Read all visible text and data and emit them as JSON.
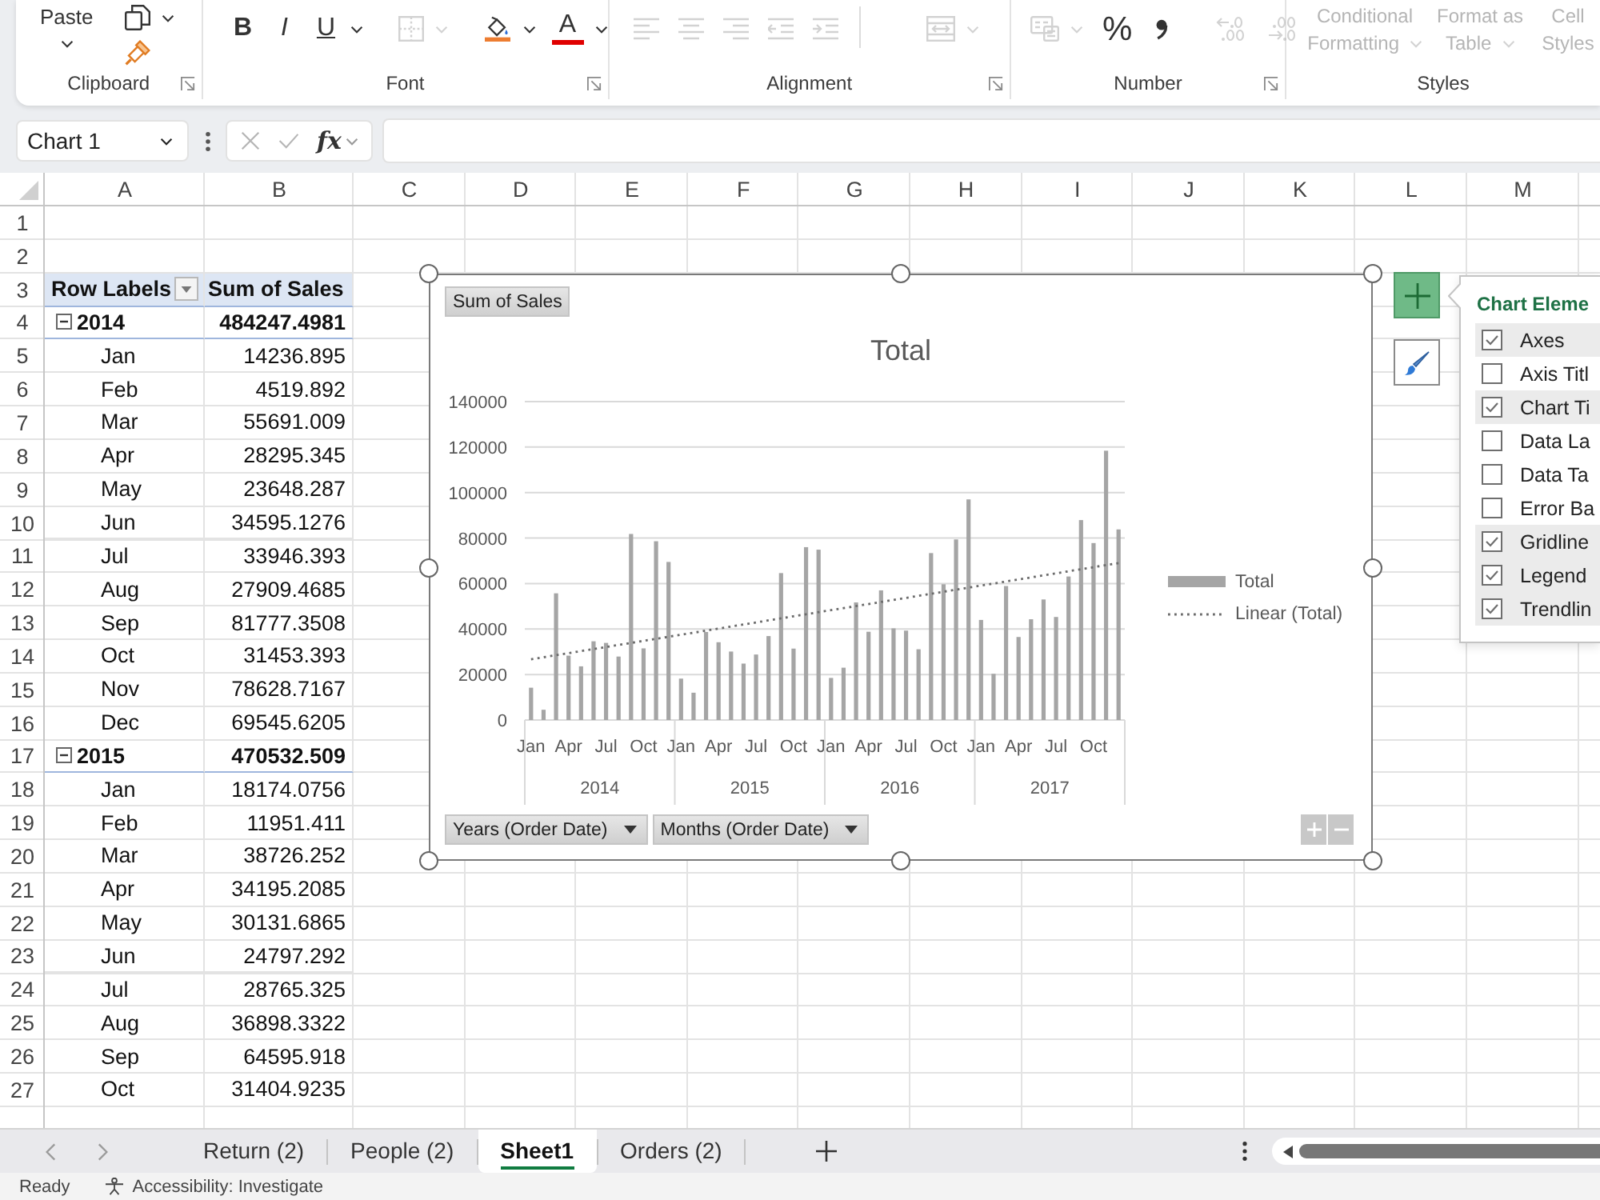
{
  "ribbon": {
    "groups": [
      {
        "kind": "clipboard",
        "label": "Clipboard",
        "launcher": true,
        "tools": [
          {
            "kind": "paste",
            "label": "Paste",
            "disabled": false
          },
          {
            "kind": "copy",
            "disabled": false
          },
          {
            "kind": "format-painter",
            "disabled": false
          }
        ]
      },
      {
        "kind": "font",
        "label": "Font",
        "launcher": true,
        "tools": [
          {
            "kind": "bold",
            "label": "B",
            "disabled": false
          },
          {
            "kind": "italic",
            "label": "I",
            "disabled": false
          },
          {
            "kind": "underline",
            "label": "U",
            "disabled": false
          },
          {
            "kind": "borders",
            "disabled": true
          },
          {
            "kind": "fill-color",
            "disabled": false
          },
          {
            "kind": "font-color",
            "label": "A",
            "disabled": false
          }
        ]
      },
      {
        "kind": "alignment",
        "label": "Alignment",
        "launcher": true,
        "tools": [
          {
            "kind": "align-left",
            "disabled": true
          },
          {
            "kind": "align-center",
            "disabled": true
          },
          {
            "kind": "align-right",
            "disabled": true
          },
          {
            "kind": "decrease-indent",
            "disabled": true
          },
          {
            "kind": "increase-indent",
            "disabled": true
          },
          {
            "kind": "merge",
            "disabled": true
          }
        ]
      },
      {
        "kind": "number",
        "label": "Number",
        "launcher": true,
        "tools": [
          {
            "kind": "number-format",
            "disabled": true
          },
          {
            "kind": "percent",
            "label": "%",
            "disabled": false
          },
          {
            "kind": "comma",
            "disabled": false
          },
          {
            "kind": "increase-decimal",
            "disabled": true
          },
          {
            "kind": "decrease-decimal",
            "disabled": true
          }
        ]
      },
      {
        "kind": "styles",
        "label": "Styles",
        "launcher": false,
        "tools": [
          {
            "kind": "conditional-formatting",
            "label": "Conditional Formatting",
            "disabled": true
          },
          {
            "kind": "format-as-table",
            "label": "Format as Table",
            "disabled": true
          },
          {
            "kind": "cell-styles",
            "label": "Cell Styles",
            "disabled": true
          }
        ]
      }
    ]
  },
  "formula_bar": {
    "name_box": "Chart 1",
    "function_label": "fx"
  },
  "sheet": {
    "columns": [
      "A",
      "B",
      "C",
      "D",
      "E",
      "F",
      "G",
      "H",
      "I",
      "J",
      "K",
      "L",
      "M"
    ],
    "rows": [
      "1",
      "2",
      "3",
      "4",
      "5",
      "6",
      "7",
      "8",
      "9",
      "10",
      "11",
      "12",
      "13",
      "14",
      "15",
      "16",
      "17",
      "18",
      "19",
      "20",
      "21",
      "22",
      "23",
      "24",
      "25",
      "26",
      "27"
    ]
  },
  "pivot_table": {
    "row_labels": "Row Labels",
    "values_header": "Sum of Sales",
    "groups": [
      {
        "label": "2014",
        "total": "484247.4981",
        "expanded": true,
        "children": [
          {
            "label": "Jan",
            "value": "14236.895"
          },
          {
            "label": "Feb",
            "value": "4519.892"
          },
          {
            "label": "Mar",
            "value": "55691.009"
          },
          {
            "label": "Apr",
            "value": "28295.345"
          },
          {
            "label": "May",
            "value": "23648.287"
          },
          {
            "label": "Jun",
            "value": "34595.1276"
          },
          {
            "label": "Jul",
            "value": "33946.393"
          },
          {
            "label": "Aug",
            "value": "27909.4685"
          },
          {
            "label": "Sep",
            "value": "81777.3508"
          },
          {
            "label": "Oct",
            "value": "31453.393"
          },
          {
            "label": "Nov",
            "value": "78628.7167"
          },
          {
            "label": "Dec",
            "value": "69545.6205"
          }
        ]
      },
      {
        "label": "2015",
        "total": "470532.509",
        "expanded": true,
        "children": [
          {
            "label": "Jan",
            "value": "18174.0756"
          },
          {
            "label": "Feb",
            "value": "11951.411"
          },
          {
            "label": "Mar",
            "value": "38726.252"
          },
          {
            "label": "Apr",
            "value": "34195.2085"
          },
          {
            "label": "May",
            "value": "30131.6865"
          },
          {
            "label": "Jun",
            "value": "24797.292"
          },
          {
            "label": "Jul",
            "value": "28765.325"
          },
          {
            "label": "Aug",
            "value": "36898.3322"
          },
          {
            "label": "Sep",
            "value": "64595.918"
          },
          {
            "label": "Oct",
            "value": "31404.9235"
          }
        ]
      }
    ]
  },
  "chart": {
    "selected": true,
    "value_field": "Sum of Sales",
    "axis_fields": [
      "Years (Order Date)",
      "Months (Order Date)"
    ],
    "chart_data": {
      "type": "bar",
      "title": "Total",
      "categories": [
        "Jan",
        null,
        null,
        "Apr",
        null,
        null,
        "Jul",
        null,
        null,
        "Oct",
        null,
        null,
        "Jan",
        null,
        null,
        "Apr",
        null,
        null,
        "Jul",
        null,
        null,
        "Oct",
        null,
        null,
        "Jan",
        null,
        null,
        "Apr",
        null,
        null,
        "Jul",
        null,
        null,
        "Oct",
        null,
        null,
        "Jan",
        null,
        null,
        "Apr",
        null,
        null,
        "Jul",
        null,
        null,
        "Oct",
        null,
        null
      ],
      "series": [
        {
          "name": "Total",
          "color": "#a5a5a5",
          "values": [
            14200,
            4500,
            55700,
            28300,
            23600,
            34600,
            33900,
            27900,
            81800,
            31500,
            78600,
            69500,
            18200,
            12000,
            38700,
            34200,
            30100,
            24800,
            28800,
            36900,
            64600,
            31400,
            76000,
            74900,
            18500,
            23000,
            51700,
            38800,
            57000,
            40300,
            39300,
            31100,
            73400,
            59700,
            79400,
            97000,
            44000,
            20300,
            58900,
            36500,
            44300,
            53000,
            45300,
            63100,
            87900,
            77800,
            118400,
            83800
          ]
        },
        {
          "name": "Linear (Total)",
          "type": "line",
          "line_style": "dotted",
          "color": "#6b6b6b",
          "values": [
            26700,
            27600,
            28500,
            29400,
            30300,
            31200,
            32100,
            33000,
            33900,
            34800,
            35700,
            36600,
            37500,
            38400,
            39300,
            40200,
            41100,
            42000,
            42900,
            43800,
            44700,
            45600,
            46500,
            47400,
            48300,
            49200,
            50100,
            51000,
            51900,
            52800,
            53700,
            54600,
            55500,
            56400,
            57300,
            58200,
            59100,
            60000,
            60900,
            61800,
            62700,
            63600,
            64500,
            65400,
            66300,
            67200,
            68100,
            69000
          ]
        }
      ],
      "ylim": [
        0,
        140000
      ],
      "yticks": [
        0,
        20000,
        40000,
        60000,
        80000,
        100000,
        120000,
        140000
      ],
      "grid": true,
      "annotations": [
        "2014",
        "2015",
        "2016",
        "2017"
      ]
    }
  },
  "chart_buttons": [
    {
      "kind": "chart-elements",
      "selected": true
    },
    {
      "kind": "chart-styles",
      "selected": false
    }
  ],
  "chart_elements_panel": {
    "title": "Chart Eleme",
    "items": [
      {
        "label": "Axes",
        "checked": true
      },
      {
        "label": "Axis Titl",
        "checked": false
      },
      {
        "label": "Chart Ti",
        "checked": true
      },
      {
        "label": "Data La",
        "checked": false
      },
      {
        "label": "Data Ta",
        "checked": false
      },
      {
        "label": "Error Ba",
        "checked": false
      },
      {
        "label": "Gridline",
        "checked": true
      },
      {
        "label": "Legend",
        "checked": true
      },
      {
        "label": "Trendlin",
        "checked": true
      }
    ]
  },
  "sheet_tabs": [
    {
      "label": "Return (2)",
      "selected": false
    },
    {
      "label": "People (2)",
      "selected": false
    },
    {
      "label": "Sheet1",
      "selected": true
    },
    {
      "label": "Orders (2)",
      "selected": false
    }
  ],
  "status_bar": {
    "mode": "Ready",
    "accessibility": "Accessibility: Investigate"
  }
}
